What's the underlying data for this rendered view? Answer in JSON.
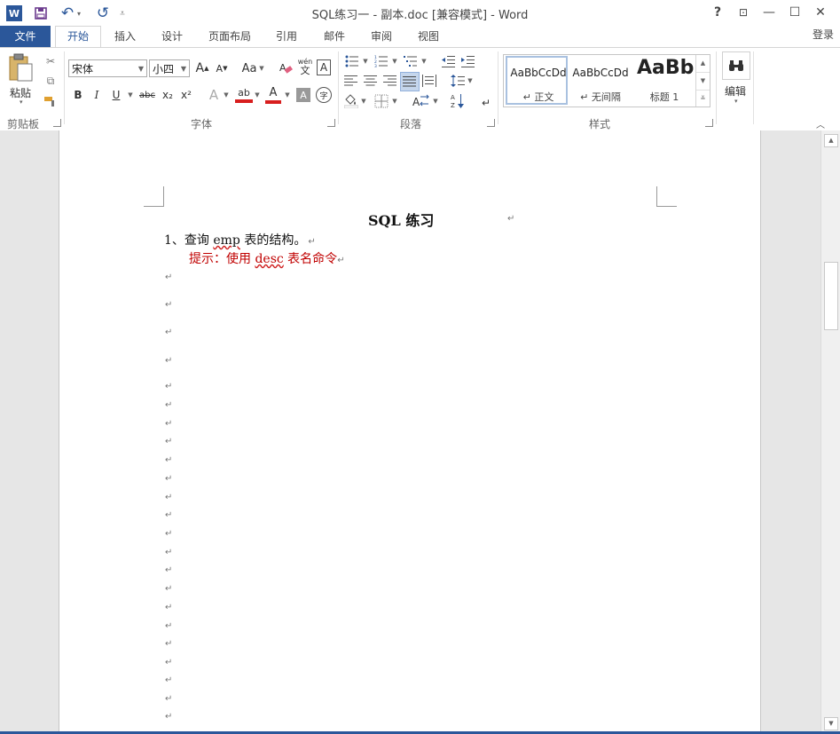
{
  "window": {
    "title": "SQL练习一 - 副本.doc [兼容模式] - Word",
    "help": "?",
    "restore_ribbon": "⊡",
    "minimize": "—",
    "maximize": "☐",
    "close": "✕",
    "login": "登录"
  },
  "quick_access": {
    "word_logo": "W",
    "save": "💾",
    "undo": "↶",
    "redo": "↺",
    "customize": "⩡"
  },
  "tabs": [
    "文件",
    "开始",
    "插入",
    "设计",
    "页面布局",
    "引用",
    "邮件",
    "审阅",
    "视图"
  ],
  "ribbon": {
    "clipboard": {
      "paste": "粘贴",
      "label": "剪贴板"
    },
    "font": {
      "font_name": "宋体",
      "font_size": "小四",
      "grow": "A",
      "shrink": "A",
      "case": "Aa",
      "pinyin_top": "wén",
      "pinyin_bottom": "文",
      "border_char": "A",
      "bold": "B",
      "italic": "I",
      "underline": "U",
      "strike": "abc",
      "sub": "x₂",
      "sup": "x²",
      "effects": "A",
      "highlight": "ab",
      "font_color": "A",
      "shade": "A",
      "enclose": "字",
      "label": "字体"
    },
    "paragraph": {
      "label": "段落"
    },
    "styles": {
      "items": [
        {
          "preview": "AaBbCcDd",
          "name": "↵ 正文"
        },
        {
          "preview": "AaBbCcDd",
          "name": "↵ 无间隔"
        },
        {
          "preview": "AaBb",
          "name": "标题 1"
        }
      ],
      "label": "样式"
    },
    "editing": {
      "label": "编辑"
    },
    "collapse": "︿"
  },
  "document": {
    "title": "SQL 练习",
    "item1_prefix": "1、",
    "item1_text_a": "查询 ",
    "item1_text_emp": "emp",
    "item1_text_b": " 表的结构。",
    "hint_a": "提示：使用 ",
    "hint_desc": "desc",
    "hint_b": " 表名命令",
    "para_mark": "↵"
  },
  "colors": {
    "word_blue": "#2b579a",
    "hint_red": "#c00000"
  }
}
